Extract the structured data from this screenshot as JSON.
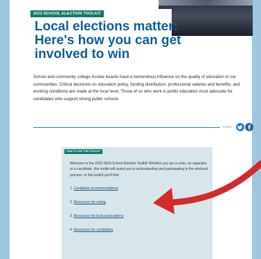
{
  "header": {
    "tag": "2023 SCHOOL ELECTION TOOLKIT",
    "headline": "Local elections matter: Here's how you can get involved to win"
  },
  "intro": "School and community college trustee boards have a tremendous influence on the quality of education in our communities. Critical decisions on education policy, funding distribution, professional salaries and benefits, and working conditions are made at the local level. Those of us who work in public education must advocate for candidates who support strong public schools.",
  "share": {
    "label": "SHARE",
    "icons": [
      "twitter-icon",
      "facebook-icon"
    ]
  },
  "howto": {
    "tag": "HOW TO USE THIS TOOLKIT",
    "text": "Welcome to the 2023 ISEA School Election Toolkit! Whether you are a voter, an organizer or a candidate, this toolkit will assist you in understanding and participating in the electoral process. In this toolkit you'll find:",
    "items": [
      {
        "num": "1.",
        "label": "Candidate recommendations",
        "end": "."
      },
      {
        "num": "2.",
        "label": "Resources for voting",
        "end": "."
      },
      {
        "num": "3.",
        "label": "Resources for local associations",
        "end": "."
      },
      {
        "num": "4.",
        "label": "Resources for candidates",
        "end": "."
      }
    ]
  },
  "colors": {
    "background": "#9fc6e0",
    "headline": "#0d5f99",
    "tag": "#0f7a6b",
    "howto_bg": "#d7e6ea",
    "arrow": "#d42a2a"
  }
}
